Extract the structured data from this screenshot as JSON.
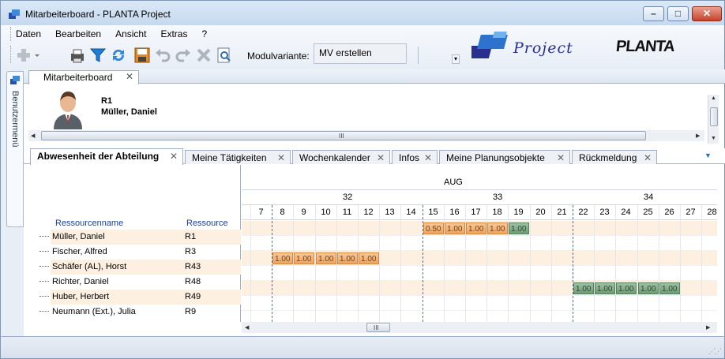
{
  "window": {
    "title": "Mitarbeiterboard - PLANTA Project",
    "min_glyph": "–",
    "max_glyph": "□",
    "close_glyph": "✕"
  },
  "menu": {
    "items": [
      "Daten",
      "Bearbeiten",
      "Ansicht",
      "Extras",
      "?"
    ]
  },
  "toolbar": {
    "variant_label": "Modulvariante:",
    "variant_value": "MV erstellen",
    "overflow_glyph": "▾",
    "icons": [
      "add-icon",
      "print-icon",
      "filter-icon",
      "refresh-icon",
      "save-icon",
      "undo-icon",
      "redo-icon",
      "delete-icon",
      "preview-icon"
    ]
  },
  "logos": {
    "project": "Project",
    "planta": "PLANTA"
  },
  "side_panel": {
    "label": "Benutzermenü"
  },
  "document_tab": {
    "label": "Mitarbeiterboard",
    "close": "✕"
  },
  "resource_header": {
    "id": "R1",
    "name": "Müller, Daniel"
  },
  "scroll": {
    "grip": "III"
  },
  "sub_tabs": [
    {
      "label": "Abwesenheit der Abteilung",
      "active": true
    },
    {
      "label": "Meine Tätigkeiten",
      "active": false
    },
    {
      "label": "Wochenkalender",
      "active": false
    },
    {
      "label": "Infos",
      "active": false
    },
    {
      "label": "Meine Planungsobjekte",
      "active": false
    },
    {
      "label": "Rückmeldung",
      "active": false
    }
  ],
  "sub_tab_close": "✕",
  "sub_tab_menu": "▼",
  "grid": {
    "columns": {
      "name": "Ressourcenname",
      "id": "Ressource"
    },
    "rows": [
      {
        "name": "Müller, Daniel",
        "id": "R1"
      },
      {
        "name": "Fischer, Alfred",
        "id": "R3"
      },
      {
        "name": "Schäfer (AL), Horst",
        "id": "R43"
      },
      {
        "name": "Richter, Daniel",
        "id": "R48"
      },
      {
        "name": "Huber, Herbert",
        "id": "R49"
      },
      {
        "name": "Neumann (Ext.), Julia",
        "id": "R9"
      }
    ]
  },
  "calendar": {
    "month": "AUG",
    "weeks": [
      {
        "label": "32",
        "first_day_index": 1
      },
      {
        "label": "33",
        "first_day_index": 8
      },
      {
        "label": "34",
        "first_day_index": 15
      }
    ],
    "days": [
      "7",
      "8",
      "9",
      "10",
      "11",
      "12",
      "13",
      "14",
      "15",
      "16",
      "17",
      "18",
      "19",
      "20",
      "21",
      "22",
      "23",
      "24",
      "25",
      "26",
      "27",
      "28"
    ],
    "bars": [
      {
        "row": 0,
        "day": 8,
        "value": "0.50",
        "color": "orange"
      },
      {
        "row": 0,
        "day": 9,
        "value": "1.00",
        "color": "orange"
      },
      {
        "row": 0,
        "day": 10,
        "value": "1.00",
        "color": "orange"
      },
      {
        "row": 0,
        "day": 11,
        "value": "1.00",
        "color": "orange"
      },
      {
        "row": 0,
        "day": 12,
        "value": "1.00",
        "color": "green"
      },
      {
        "row": 2,
        "day": 1,
        "value": "1.00",
        "color": "orange"
      },
      {
        "row": 2,
        "day": 2,
        "value": "1.00",
        "color": "orange"
      },
      {
        "row": 2,
        "day": 3,
        "value": "1.00",
        "color": "orange"
      },
      {
        "row": 2,
        "day": 4,
        "value": "1.00",
        "color": "orange"
      },
      {
        "row": 2,
        "day": 5,
        "value": "1.00",
        "color": "orange"
      },
      {
        "row": 4,
        "day": 15,
        "value": "1.00",
        "color": "green"
      },
      {
        "row": 4,
        "day": 16,
        "value": "1.00",
        "color": "green"
      },
      {
        "row": 4,
        "day": 17,
        "value": "1.00",
        "color": "green"
      },
      {
        "row": 4,
        "day": 18,
        "value": "1.00",
        "color": "green"
      },
      {
        "row": 4,
        "day": 19,
        "value": "1.00",
        "color": "green"
      }
    ]
  },
  "colors": {
    "orange_bar": "#f0a35b",
    "green_bar": "#6e9b76",
    "row_highlight": "#fdf0e0",
    "column_header": "#1a3f9e"
  }
}
